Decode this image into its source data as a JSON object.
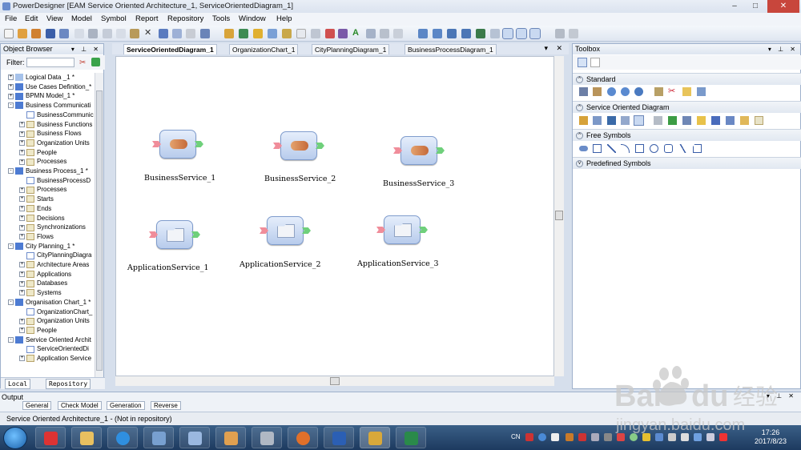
{
  "window": {
    "title": "PowerDesigner [EAM Service Oriented Architecture_1, ServiceOrientedDiagram_1]"
  },
  "menu": [
    "File",
    "Edit",
    "View",
    "Model",
    "Symbol",
    "Report",
    "Repository",
    "Tools",
    "Window",
    "Help"
  ],
  "object_browser": {
    "title": "Object Browser",
    "filter_label": "Filter:",
    "filter_value": "",
    "tree": [
      {
        "label": "Logical Data _1 *",
        "level": 0,
        "icon": "ldm",
        "exp": "+"
      },
      {
        "label": "Use Cases Definition_*",
        "level": 0,
        "icon": "mdl",
        "exp": "+"
      },
      {
        "label": "BPMN Model_1 *",
        "level": 0,
        "icon": "mdl",
        "exp": "+"
      },
      {
        "label": "Business Communicati",
        "level": 0,
        "icon": "mdl",
        "exp": "-"
      },
      {
        "label": "BusinessCommunic",
        "level": 1,
        "icon": "dgm",
        "exp": ""
      },
      {
        "label": "Business Functions",
        "level": 1,
        "icon": "fold",
        "exp": "+"
      },
      {
        "label": "Business Flows",
        "level": 1,
        "icon": "fold",
        "exp": "+"
      },
      {
        "label": "Organization Units",
        "level": 1,
        "icon": "fold",
        "exp": "+"
      },
      {
        "label": "People",
        "level": 1,
        "icon": "fold",
        "exp": "+"
      },
      {
        "label": "Processes",
        "level": 1,
        "icon": "fold",
        "exp": "+"
      },
      {
        "label": "Business Process_1 *",
        "level": 0,
        "icon": "mdl",
        "exp": "-"
      },
      {
        "label": "BusinessProcessD",
        "level": 1,
        "icon": "dgm",
        "exp": ""
      },
      {
        "label": "Processes",
        "level": 1,
        "icon": "fold",
        "exp": "+"
      },
      {
        "label": "Starts",
        "level": 1,
        "icon": "fold",
        "exp": "+"
      },
      {
        "label": "Ends",
        "level": 1,
        "icon": "fold",
        "exp": "+"
      },
      {
        "label": "Decisions",
        "level": 1,
        "icon": "fold",
        "exp": "+"
      },
      {
        "label": "Synchronizations",
        "level": 1,
        "icon": "fold",
        "exp": "+"
      },
      {
        "label": "Flows",
        "level": 1,
        "icon": "fold",
        "exp": "+"
      },
      {
        "label": "City Planning_1 *",
        "level": 0,
        "icon": "mdl",
        "exp": "-"
      },
      {
        "label": "CityPlanningDiagra",
        "level": 1,
        "icon": "dgm",
        "exp": ""
      },
      {
        "label": "Architecture Areas",
        "level": 1,
        "icon": "fold",
        "exp": "+"
      },
      {
        "label": "Applications",
        "level": 1,
        "icon": "fold",
        "exp": "+"
      },
      {
        "label": "Databases",
        "level": 1,
        "icon": "fold",
        "exp": "+"
      },
      {
        "label": "Systems",
        "level": 1,
        "icon": "fold",
        "exp": "+"
      },
      {
        "label": "Organisation Chart_1 *",
        "level": 0,
        "icon": "mdl",
        "exp": "-"
      },
      {
        "label": "OrganizationChart_",
        "level": 1,
        "icon": "dgm",
        "exp": ""
      },
      {
        "label": "Organization Units",
        "level": 1,
        "icon": "fold",
        "exp": "+"
      },
      {
        "label": "People",
        "level": 1,
        "icon": "fold",
        "exp": "+"
      },
      {
        "label": "Service Oriented Archit",
        "level": 0,
        "icon": "mdl",
        "exp": "-"
      },
      {
        "label": "ServiceOrientedDi",
        "level": 1,
        "icon": "dgm",
        "exp": ""
      },
      {
        "label": "Application Service",
        "level": 1,
        "icon": "fold",
        "exp": "+"
      }
    ],
    "bottom_tabs": [
      "Local",
      "Repository"
    ]
  },
  "doc_tabs": [
    "ServiceOrientedDiagram_1",
    "OrganizationChart_1",
    "CityPlanningDiagram_1",
    "BusinessProcessDiagram_1"
  ],
  "diagram": {
    "symbols": [
      {
        "label": "BusinessService_1",
        "kind": "business"
      },
      {
        "label": "BusinessService_2",
        "kind": "business"
      },
      {
        "label": "BusinessService_3",
        "kind": "business"
      },
      {
        "label": "ApplicationService_1",
        "kind": "application"
      },
      {
        "label": "ApplicationService_2",
        "kind": "application"
      },
      {
        "label": "ApplicationService_3",
        "kind": "application"
      }
    ]
  },
  "toolbox": {
    "title": "Toolbox",
    "sections": [
      "Standard",
      "Service Oriented Diagram",
      "Free Symbols",
      "Predefined Symbols"
    ]
  },
  "output": {
    "title": "Output",
    "tabs": [
      "General",
      "Check Model",
      "Generation",
      "Reverse"
    ]
  },
  "status": {
    "text": "Service Oriented Architecture_1 - (Not in repository)"
  },
  "taskbar": {
    "time": "17:26",
    "date": "2017/8/23",
    "lang": "CN"
  }
}
